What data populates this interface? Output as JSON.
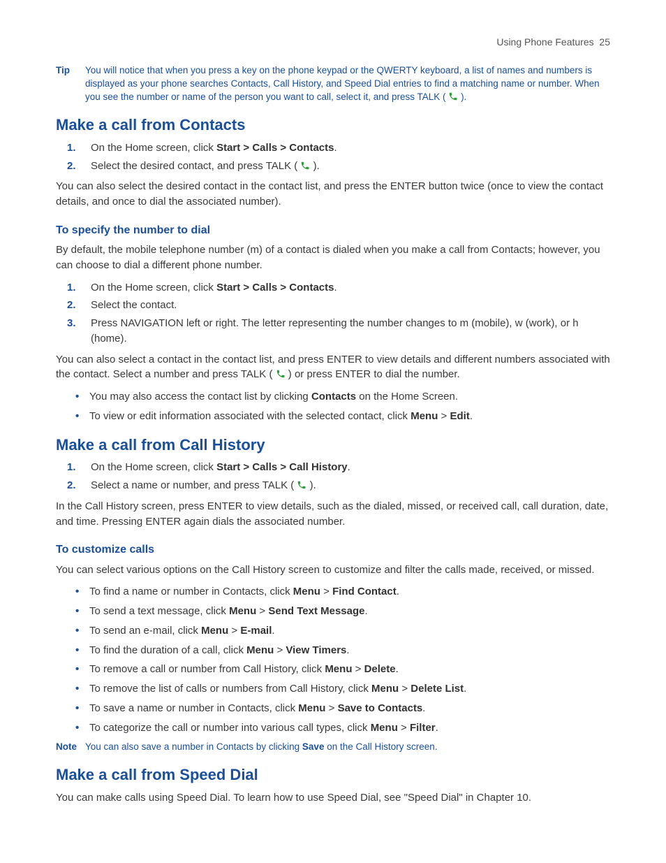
{
  "header": {
    "section": "Using Phone Features",
    "page": "25"
  },
  "tip": {
    "label": "Tip",
    "pre": "You will notice that when you press a key on the phone keypad or the QWERTY keyboard, a list of names and numbers is displayed as your phone searches Contacts, Call History,  and Speed Dial entries to find a matching name or number.   When you see the number or name of the person you want to call, select it, and press TALK (",
    "post": ")."
  },
  "sec1": {
    "title": "Make a call from Contacts",
    "step1_pre": "On the Home screen, click ",
    "step1_bold": "Start > Calls > Contacts",
    "step1_post": ".",
    "step2_pre": "Select the desired contact, and press TALK (",
    "step2_post": ").",
    "para1": "You can also select the desired contact in the contact list, and press the ENTER button twice (once to view the contact details, and once to dial the associated number)."
  },
  "sec1sub": {
    "title": "To specify the number to dial",
    "para1": "By default, the mobile telephone number (m) of a contact is dialed when you make a call from Contacts; however, you can choose to dial a different phone number.",
    "step1_pre": "On the Home screen, click ",
    "step1_bold": "Start > Calls > Contacts",
    "step1_post": ".",
    "step2": "Select the contact.",
    "step3": "Press NAVIGATION left or right. The letter representing the number changes to m (mobile), w (work), or h (home).",
    "para2_pre": "You can also select a contact in the contact list, and press ENTER to view details and different numbers associated with the contact. Select a number and press TALK (",
    "para2_post": ") or press ENTER to dial the number.",
    "bul1_pre": "You may also access the contact list by clicking ",
    "bul1_bold": "Contacts",
    "bul1_post": " on the Home Screen.",
    "bul2_pre": "To view or edit information associated with the selected contact, click ",
    "bul2_b1": "Menu",
    "bul2_mid": " > ",
    "bul2_b2": "Edit",
    "bul2_post": "."
  },
  "sec2": {
    "title": "Make a call from Call History",
    "step1_pre": "On the Home screen, click ",
    "step1_bold": "Start > Calls > Call History",
    "step1_post": ".",
    "step2_pre": "Select a name or number, and press TALK (",
    "step2_post": ").",
    "para1": "In the Call History screen, press ENTER to view details, such as the dialed, missed, or received call, call duration, date, and time. Pressing ENTER again dials the associated number."
  },
  "sec2sub": {
    "title": "To customize calls",
    "para1": "You can select various options on the Call History screen to customize and filter the calls made, received, or missed.",
    "b1_pre": "To find a name or number in Contacts, click ",
    "b1_m": "Menu",
    "b1_mid": " > ",
    "b1_a": "Find Contact",
    "b1_post": ".",
    "b2_pre": "To send a text message, click ",
    "b2_m": "Menu",
    "b2_mid": " > ",
    "b2_a": "Send Text Message",
    "b2_post": ".",
    "b3_pre": "To send an e-mail, click ",
    "b3_m": "Menu",
    "b3_mid": " > ",
    "b3_a": "E-mail",
    "b3_post": ".",
    "b4_pre": "To find the duration of a call, click ",
    "b4_m": "Menu",
    "b4_mid": " > ",
    "b4_a": "View Timers",
    "b4_post": ".",
    "b5_pre": "To remove a call or number from Call History, click ",
    "b5_m": "Menu",
    "b5_mid": " > ",
    "b5_a": "Delete",
    "b5_post": ".",
    "b6_pre": "To remove the list of calls or numbers from Call History, click ",
    "b6_m": "Menu",
    "b6_mid": " > ",
    "b6_a": "Delete List",
    "b6_post": ".",
    "b7_pre": "To save a name or number in Contacts, click ",
    "b7_m": "Menu",
    "b7_mid": " > ",
    "b7_a": "Save to Contacts",
    "b7_post": ".",
    "b8_pre": "To categorize the call or number into various call types, click ",
    "b8_m": "Menu",
    "b8_mid": " > ",
    "b8_a": "Filter",
    "b8_post": "."
  },
  "note": {
    "label": "Note",
    "pre": "You can also save a number in Contacts by clicking ",
    "bold": "Save",
    "post": " on the Call History screen."
  },
  "sec3": {
    "title": "Make a call from Speed Dial",
    "para1": "You can make calls using Speed Dial. To learn how to use Speed Dial, see \"Speed Dial\" in Chapter 10."
  }
}
